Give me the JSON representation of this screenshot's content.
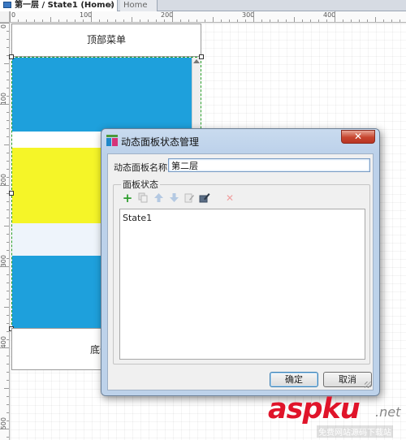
{
  "tabs": [
    {
      "label": "第一层 / State1 (Home)",
      "close": "×",
      "active": true
    },
    {
      "label": "Home",
      "active": false
    }
  ],
  "rulers": {
    "top": [
      "0",
      "100",
      "200",
      "300",
      "400"
    ],
    "left": [
      "0",
      "100",
      "200",
      "300",
      "400",
      "500"
    ]
  },
  "canvas": {
    "top_menu": "顶部菜单",
    "bottom_menu": "底部"
  },
  "dialog": {
    "title": "动态面板状态管理",
    "close": "✕",
    "name_label": "动态面板名称:",
    "name_value": "第二层",
    "group_label": "面板状态",
    "toolbar": [
      "add-icon",
      "duplicate-icon",
      "move-up-icon",
      "move-down-icon",
      "edit-icon",
      "edit-all-icon",
      "delete-icon"
    ],
    "states": [
      "State1"
    ],
    "ok": "确定",
    "cancel": "取消"
  },
  "watermark": {
    "brand": "aspku",
    "suffix": ".net",
    "sub": "免费网站源码下载站"
  },
  "colors": {
    "accent": "#1ea0dc",
    "panel_yellow": "#f5f528",
    "add_green": "#2e9e2e",
    "delete_red": "#e04040",
    "watermark_red": "#e0142a"
  }
}
